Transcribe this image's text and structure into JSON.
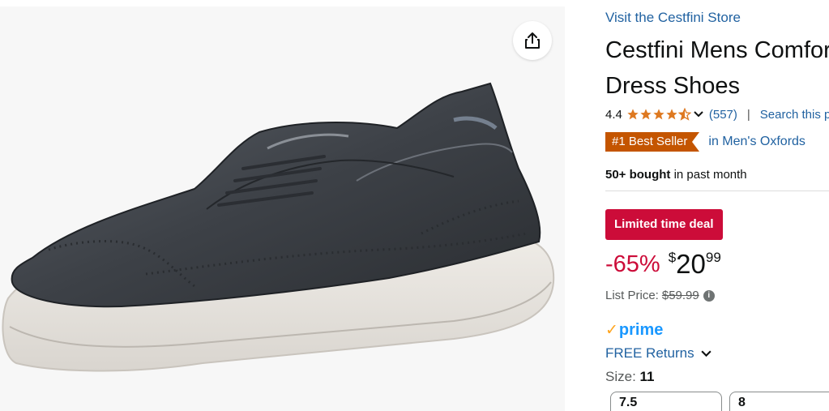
{
  "store_link": "Visit the Cestfini Store",
  "title": "Cestfini Mens Comfort Dress Shoes",
  "rating": {
    "value": "4.4",
    "stars_out_of_5": 4.4,
    "count": "(557)",
    "separator": "|",
    "search_link": "Search this page"
  },
  "best_seller": {
    "badge": "#1 Best Seller",
    "category": "in Men's Oxfords"
  },
  "bought": {
    "bold": "50+ bought",
    "rest": " in past month"
  },
  "deal_badge": "Limited time deal",
  "price": {
    "discount": "-65%",
    "currency": "$",
    "whole": "20",
    "fraction": "99",
    "list_label": "List Price:",
    "list_value": "$59.99"
  },
  "prime": "prime",
  "free_returns": "FREE Returns",
  "size": {
    "label": "Size:",
    "selected": "11",
    "options": [
      "7.5",
      "8"
    ]
  },
  "icons": {
    "share": "share-icon",
    "info": "info-icon",
    "chevron": "chevron-down-icon",
    "star": "star-icon"
  },
  "colors": {
    "link": "#2162a1",
    "deal": "#cc0c39",
    "best_seller": "#c45500",
    "star": "#de7921",
    "prime_blue": "#1a98ff",
    "prime_check": "#ffa41c"
  }
}
